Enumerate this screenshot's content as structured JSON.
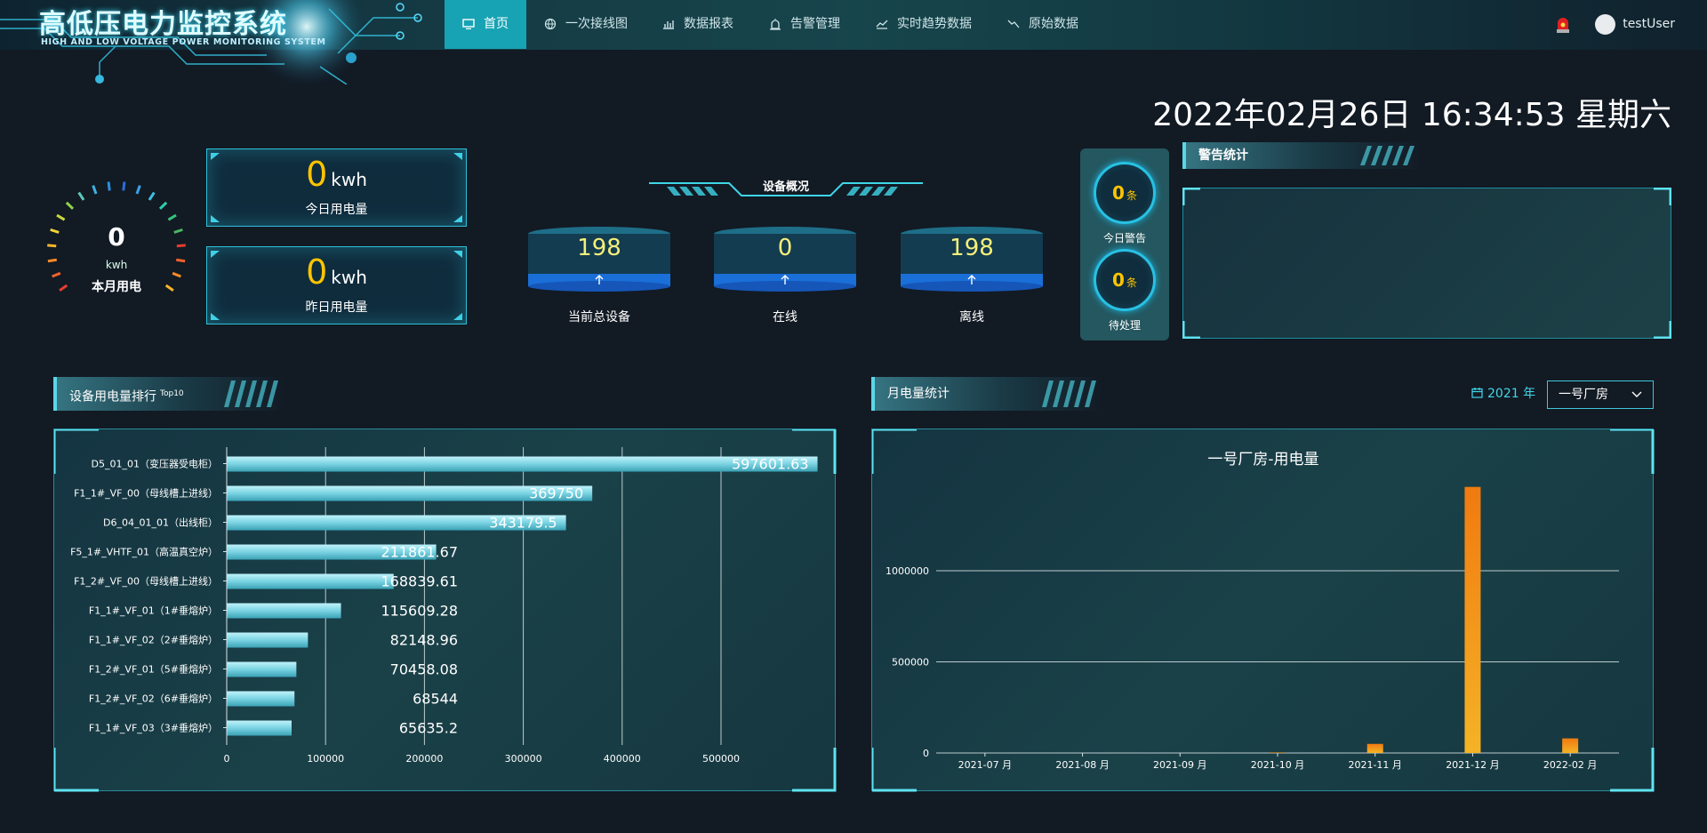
{
  "header": {
    "title": "高低压电力监控系统",
    "subtitle": "HIGH AND LOW VOLTAGE POWER MONITORING SYSTEM",
    "nav": [
      {
        "label": "首页",
        "icon": "monitor-icon",
        "active": true
      },
      {
        "label": "一次接线图",
        "icon": "globe-icon"
      },
      {
        "label": "数据报表",
        "icon": "bar-chart-icon"
      },
      {
        "label": "告警管理",
        "icon": "alarm-icon"
      },
      {
        "label": "实时趋势数据",
        "icon": "trend-up-icon"
      },
      {
        "label": "原始数据",
        "icon": "trend-down-icon"
      }
    ],
    "user": "testUser"
  },
  "datetime": "2022年02月26日 16:34:53 星期六",
  "gauge": {
    "value": "0",
    "unit": "kwh",
    "label": "本月用电"
  },
  "today": {
    "value": "0",
    "unit": "kwh",
    "label": "今日用电量"
  },
  "yesterday": {
    "value": "0",
    "unit": "kwh",
    "label": "昨日用电量"
  },
  "overview": {
    "title": "设备概况",
    "items": [
      {
        "value": "198",
        "label": "当前总设备"
      },
      {
        "value": "0",
        "label": "在线"
      },
      {
        "value": "198",
        "label": "离线"
      }
    ]
  },
  "alarms": {
    "today": {
      "value": "0",
      "unit": "条",
      "label": "今日警告"
    },
    "pending": {
      "value": "0",
      "unit": "条",
      "label": "待处理"
    }
  },
  "warning_stats": {
    "title": "警告统计"
  },
  "ranking": {
    "title": "设备用电量排行",
    "badge": "Top10"
  },
  "monthly": {
    "title": "月电量统计",
    "year": "2021 年",
    "factory": "一号厂房"
  },
  "chart_data": [
    {
      "type": "bar",
      "orientation": "horizontal",
      "categories": [
        "D5_01_01（变压器受电柜）",
        "F1_1#_VF_00（母线槽上进线）",
        "D6_04_01_01（出线柜）",
        "F5_1#_VHTF_01（高温真空炉）",
        "F1_2#_VF_00（母线槽上进线）",
        "F1_1#_VF_01（1#垂熔炉）",
        "F1_1#_VF_02（2#垂熔炉）",
        "F1_2#_VF_01（5#垂熔炉）",
        "F1_2#_VF_02（6#垂熔炉）",
        "F1_1#_VF_03（3#垂熔炉）"
      ],
      "values": [
        597601.63,
        369750,
        343179.5,
        211861.67,
        168839.61,
        115609.28,
        82148.96,
        70458.08,
        68544,
        65635.2
      ],
      "labels": [
        "597601.63",
        "369750",
        "343179.5",
        "211861.67",
        "168839.61",
        "115609.28",
        "82148.96",
        "70458.08",
        "68544",
        "65635.2"
      ],
      "xticks": [
        "0",
        "100000",
        "200000",
        "300000",
        "400000",
        "500000"
      ],
      "xlim": [
        0,
        600000
      ],
      "grid": "vertical"
    },
    {
      "type": "bar",
      "title": "一号厂房-用电量",
      "categories": [
        "2021-07 月",
        "2021-08 月",
        "2021-09 月",
        "2021-10 月",
        "2021-11 月",
        "2021-12 月",
        "2022-02 月"
      ],
      "values": [
        0,
        0,
        0,
        3000,
        50000,
        1460000,
        80000
      ],
      "yticks": [
        "0",
        "500000",
        "1000000"
      ],
      "ylim": [
        0,
        1600000
      ],
      "grid": "horizontal",
      "colors": {
        "top": "#f07a10",
        "bottom": "#f5b326"
      }
    }
  ]
}
